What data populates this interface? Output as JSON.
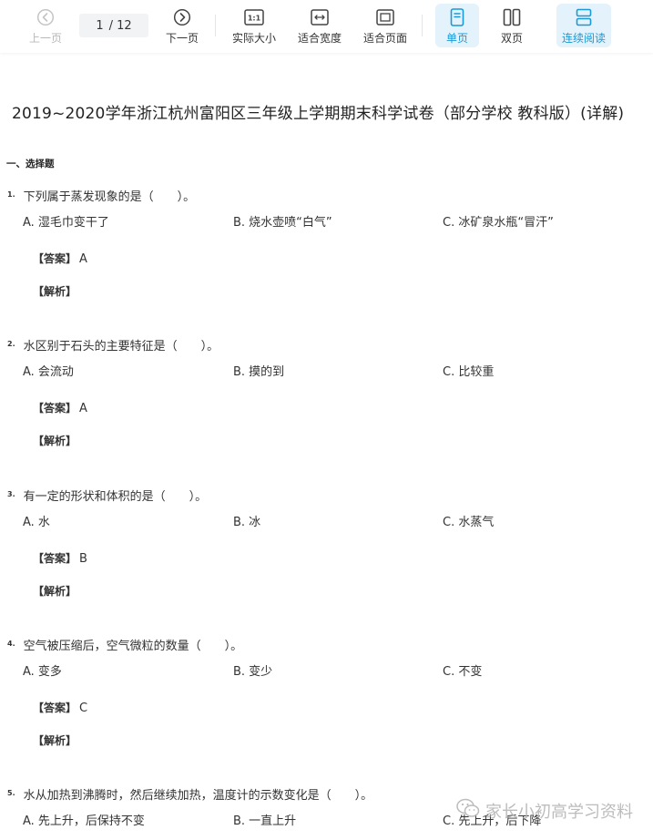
{
  "toolbar": {
    "prev": {
      "label": "上一页",
      "icon": "arrow-left-circle-icon"
    },
    "page_current": "1",
    "page_total": "/ 12",
    "next": {
      "label": "下一页",
      "icon": "arrow-right-circle-icon"
    },
    "actual_size": {
      "label": "实际大小",
      "icon": "one-to-one-icon",
      "icon_text": "1:1"
    },
    "fit_width": {
      "label": "适合宽度",
      "icon": "fit-width-icon"
    },
    "fit_page": {
      "label": "适合页面",
      "icon": "fit-page-icon"
    },
    "single_page": {
      "label": "单页",
      "icon": "single-page-icon"
    },
    "double_page": {
      "label": "双页",
      "icon": "double-page-icon"
    },
    "continuous": {
      "label": "连续阅读",
      "icon": "continuous-icon"
    },
    "accent": "#1a9ad6",
    "active_bg": "#e3f2fb"
  },
  "document": {
    "title": "2019~2020学年浙江杭州富阳区三年级上学期期末科学试卷（部分学校 教科版）(详解)",
    "section": "一、选择题",
    "answer_label": "【答案】",
    "analysis_label": "【解析】",
    "questions": [
      {
        "num": "1.",
        "stem": "下列属于蒸发现象的是（　　）。",
        "options": [
          "A. 湿毛巾变干了",
          "B. 烧水壶喷“白气”",
          "C. 冰矿泉水瓶“冒汗”"
        ],
        "answer": "A"
      },
      {
        "num": "2.",
        "stem": "水区别于石头的主要特征是（　　）。",
        "options": [
          "A. 会流动",
          "B. 摸的到",
          "C. 比较重"
        ],
        "answer": "A"
      },
      {
        "num": "3.",
        "stem": "有一定的形状和体积的是（　　）。",
        "options": [
          "A. 水",
          "B. 冰",
          "C. 水蒸气"
        ],
        "answer": "B"
      },
      {
        "num": "4.",
        "stem": "空气被压缩后，空气微粒的数量（　　）。",
        "options": [
          "A. 变多",
          "B. 变少",
          "C. 不变"
        ],
        "answer": "C"
      },
      {
        "num": "5.",
        "stem": "水从加热到沸腾时，然后继续加热，温度计的示数变化是（　　）。",
        "options": [
          "A. 先上升，后保持不变",
          "B. 一直上升",
          "C. 先上升，后下降"
        ]
      }
    ]
  },
  "watermark": {
    "text": "家长小初高学习资料",
    "icon": "wechat-icon"
  }
}
